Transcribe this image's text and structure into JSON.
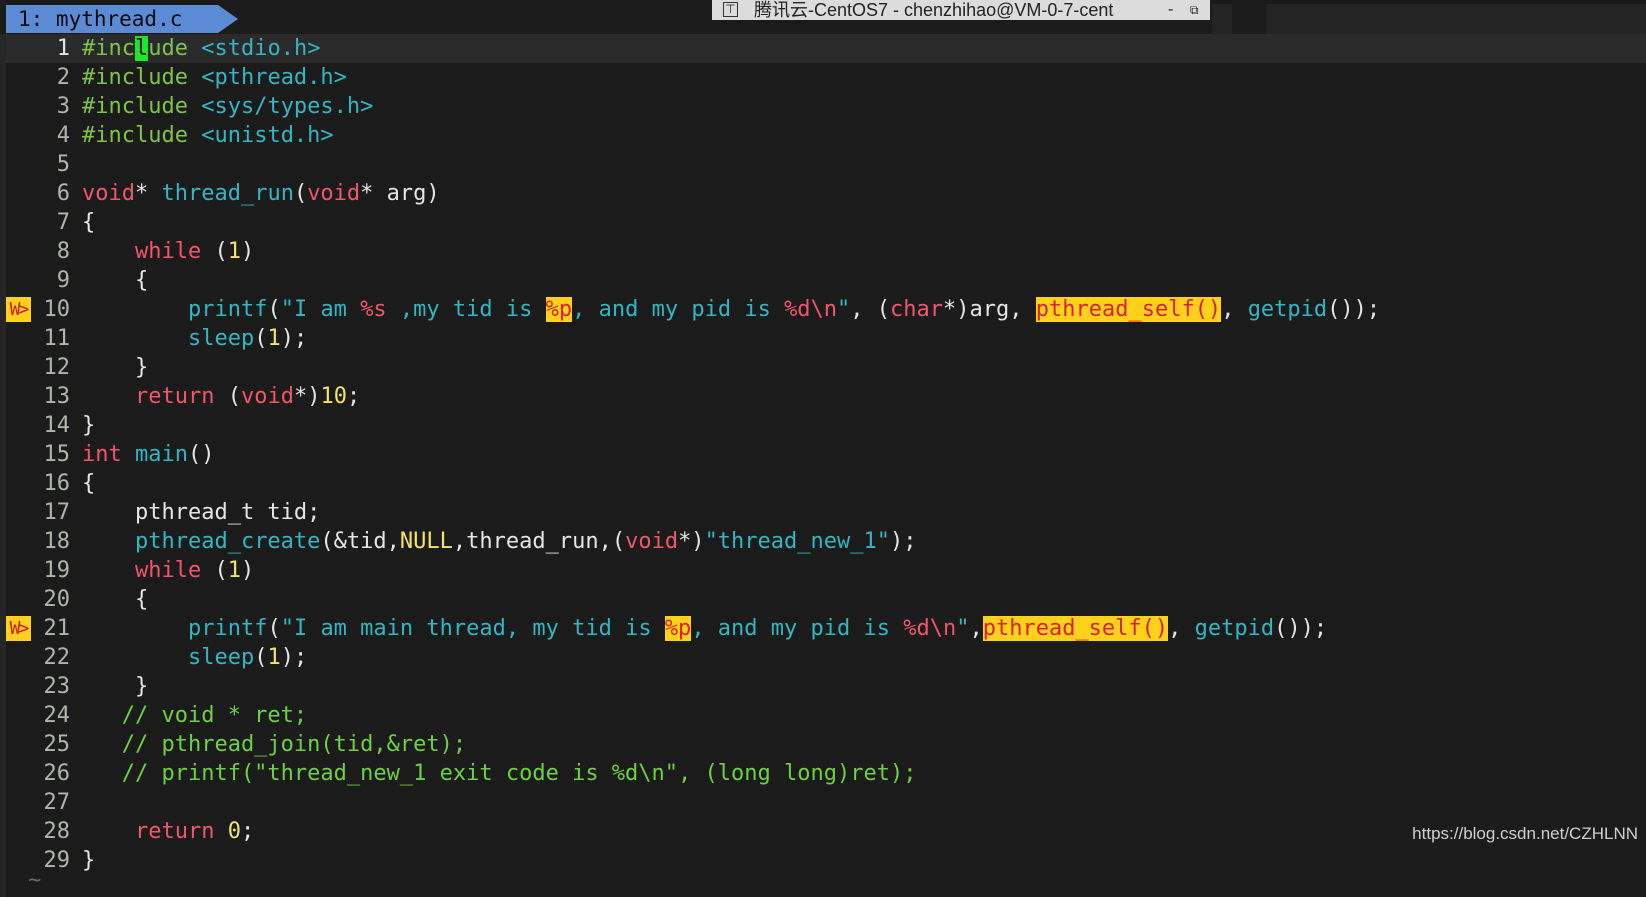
{
  "tab": {
    "label": "1: mythread.c"
  },
  "window_title": {
    "text": "腾讯云-CentOS7 - chenzhihao@VM-0-7-cent",
    "minimize": "-",
    "restore": "⧉"
  },
  "editor": {
    "current_line": 1,
    "cursor_col": 6,
    "sign_text": "W>",
    "lines": [
      {
        "n": "1",
        "sign": false,
        "tokens": [
          {
            "t": "#inc",
            "c": "pre"
          },
          {
            "t": "l",
            "c": "cursor"
          },
          {
            "t": "ude",
            "c": "pre"
          },
          {
            "t": " ",
            "c": ""
          },
          {
            "t": "<stdio.h>",
            "c": "inc"
          }
        ]
      },
      {
        "n": "2",
        "sign": false,
        "tokens": [
          {
            "t": "#include",
            "c": "pre"
          },
          {
            "t": " ",
            "c": ""
          },
          {
            "t": "<pthread.h>",
            "c": "inc"
          }
        ]
      },
      {
        "n": "3",
        "sign": false,
        "tokens": [
          {
            "t": "#include",
            "c": "pre"
          },
          {
            "t": " ",
            "c": ""
          },
          {
            "t": "<sys/types.h>",
            "c": "inc"
          }
        ]
      },
      {
        "n": "4",
        "sign": false,
        "tokens": [
          {
            "t": "#include",
            "c": "pre"
          },
          {
            "t": " ",
            "c": ""
          },
          {
            "t": "<unistd.h>",
            "c": "inc"
          }
        ]
      },
      {
        "n": "5",
        "sign": false,
        "tokens": []
      },
      {
        "n": "6",
        "sign": false,
        "tokens": [
          {
            "t": "void",
            "c": "kw"
          },
          {
            "t": "* ",
            "c": ""
          },
          {
            "t": "thread_run",
            "c": "fn"
          },
          {
            "t": "(",
            "c": ""
          },
          {
            "t": "void",
            "c": "kw"
          },
          {
            "t": "* arg)",
            "c": ""
          }
        ]
      },
      {
        "n": "7",
        "sign": false,
        "tokens": [
          {
            "t": "{",
            "c": ""
          }
        ]
      },
      {
        "n": "8",
        "sign": false,
        "tokens": [
          {
            "t": "    ",
            "c": ""
          },
          {
            "t": "while",
            "c": "kw"
          },
          {
            "t": " (",
            "c": ""
          },
          {
            "t": "1",
            "c": "num"
          },
          {
            "t": ")",
            "c": ""
          }
        ]
      },
      {
        "n": "9",
        "sign": false,
        "tokens": [
          {
            "t": "    {",
            "c": ""
          }
        ]
      },
      {
        "n": "10",
        "sign": true,
        "tokens": [
          {
            "t": "        ",
            "c": ""
          },
          {
            "t": "printf",
            "c": "fn"
          },
          {
            "t": "(",
            "c": ""
          },
          {
            "t": "\"I am ",
            "c": "str"
          },
          {
            "t": "%s",
            "c": "fmt"
          },
          {
            "t": " ,my tid is ",
            "c": "str"
          },
          {
            "t": "%p",
            "c": "hl"
          },
          {
            "t": ", and my pid is ",
            "c": "str"
          },
          {
            "t": "%d\\n",
            "c": "fmt"
          },
          {
            "t": "\"",
            "c": "str"
          },
          {
            "t": ", (",
            "c": ""
          },
          {
            "t": "char",
            "c": "kw"
          },
          {
            "t": "*)arg, ",
            "c": ""
          },
          {
            "t": "pthread_self()",
            "c": "hl"
          },
          {
            "t": ", ",
            "c": ""
          },
          {
            "t": "getpid",
            "c": "fn"
          },
          {
            "t": "());",
            "c": ""
          }
        ]
      },
      {
        "n": "11",
        "sign": false,
        "tokens": [
          {
            "t": "        ",
            "c": ""
          },
          {
            "t": "sleep",
            "c": "fn"
          },
          {
            "t": "(",
            "c": ""
          },
          {
            "t": "1",
            "c": "num"
          },
          {
            "t": ");",
            "c": ""
          }
        ]
      },
      {
        "n": "12",
        "sign": false,
        "tokens": [
          {
            "t": "    }",
            "c": ""
          }
        ]
      },
      {
        "n": "13",
        "sign": false,
        "tokens": [
          {
            "t": "    ",
            "c": ""
          },
          {
            "t": "return",
            "c": "kw"
          },
          {
            "t": " (",
            "c": ""
          },
          {
            "t": "void",
            "c": "kw"
          },
          {
            "t": "*)",
            "c": ""
          },
          {
            "t": "10",
            "c": "num"
          },
          {
            "t": ";",
            "c": ""
          }
        ]
      },
      {
        "n": "14",
        "sign": false,
        "tokens": [
          {
            "t": "}",
            "c": ""
          }
        ]
      },
      {
        "n": "15",
        "sign": false,
        "tokens": [
          {
            "t": "int",
            "c": "kw"
          },
          {
            "t": " ",
            "c": ""
          },
          {
            "t": "main",
            "c": "fn"
          },
          {
            "t": "()",
            "c": ""
          }
        ]
      },
      {
        "n": "16",
        "sign": false,
        "tokens": [
          {
            "t": "{",
            "c": ""
          }
        ]
      },
      {
        "n": "17",
        "sign": false,
        "tokens": [
          {
            "t": "    pthread_t tid;",
            "c": ""
          }
        ]
      },
      {
        "n": "18",
        "sign": false,
        "tokens": [
          {
            "t": "    ",
            "c": ""
          },
          {
            "t": "pthread_create",
            "c": "fn"
          },
          {
            "t": "(&tid,",
            "c": ""
          },
          {
            "t": "NULL",
            "c": "num"
          },
          {
            "t": ",thread_run,(",
            "c": ""
          },
          {
            "t": "void",
            "c": "kw"
          },
          {
            "t": "*)",
            "c": ""
          },
          {
            "t": "\"thread_new_1\"",
            "c": "str"
          },
          {
            "t": ");",
            "c": ""
          }
        ]
      },
      {
        "n": "19",
        "sign": false,
        "tokens": [
          {
            "t": "    ",
            "c": ""
          },
          {
            "t": "while",
            "c": "kw"
          },
          {
            "t": " (",
            "c": ""
          },
          {
            "t": "1",
            "c": "num"
          },
          {
            "t": ")",
            "c": ""
          }
        ]
      },
      {
        "n": "20",
        "sign": false,
        "tokens": [
          {
            "t": "    {",
            "c": ""
          }
        ]
      },
      {
        "n": "21",
        "sign": true,
        "tokens": [
          {
            "t": "        ",
            "c": ""
          },
          {
            "t": "printf",
            "c": "fn"
          },
          {
            "t": "(",
            "c": ""
          },
          {
            "t": "\"I am main thread, my tid is ",
            "c": "str"
          },
          {
            "t": "%p",
            "c": "hl"
          },
          {
            "t": ", and my pid is ",
            "c": "str"
          },
          {
            "t": "%d\\n",
            "c": "fmt"
          },
          {
            "t": "\"",
            "c": "str"
          },
          {
            "t": ",",
            "c": ""
          },
          {
            "t": "pthread_self()",
            "c": "hl"
          },
          {
            "t": ", ",
            "c": ""
          },
          {
            "t": "getpid",
            "c": "fn"
          },
          {
            "t": "());",
            "c": ""
          }
        ]
      },
      {
        "n": "22",
        "sign": false,
        "tokens": [
          {
            "t": "        ",
            "c": ""
          },
          {
            "t": "sleep",
            "c": "fn"
          },
          {
            "t": "(",
            "c": ""
          },
          {
            "t": "1",
            "c": "num"
          },
          {
            "t": ");",
            "c": ""
          }
        ]
      },
      {
        "n": "23",
        "sign": false,
        "tokens": [
          {
            "t": "    }",
            "c": ""
          }
        ]
      },
      {
        "n": "24",
        "sign": false,
        "tokens": [
          {
            "t": "   // void * ret;",
            "c": "cmt"
          }
        ]
      },
      {
        "n": "25",
        "sign": false,
        "tokens": [
          {
            "t": "   // pthread_join(tid,&ret);",
            "c": "cmt"
          }
        ]
      },
      {
        "n": "26",
        "sign": false,
        "tokens": [
          {
            "t": "   // printf(\"thread_new_1 exit code is %d\\n\", (long long)ret);",
            "c": "cmt"
          }
        ]
      },
      {
        "n": "27",
        "sign": false,
        "tokens": []
      },
      {
        "n": "28",
        "sign": false,
        "tokens": [
          {
            "t": "    ",
            "c": ""
          },
          {
            "t": "return",
            "c": "kw"
          },
          {
            "t": " ",
            "c": ""
          },
          {
            "t": "0",
            "c": "num"
          },
          {
            "t": ";",
            "c": ""
          }
        ]
      },
      {
        "n": "29",
        "sign": false,
        "tokens": [
          {
            "t": "}",
            "c": ""
          }
        ]
      }
    ],
    "end_of_buffer": "~"
  },
  "watermark": "https://blog.csdn.net/CZHLNN",
  "colors": {
    "background": "#1b1b1b",
    "tab_active": "#5c8bd6",
    "keyword": "#f0566a",
    "function": "#34b5c4",
    "preproc": "#7ec34a",
    "number": "#f2e36b",
    "comment": "#6cd143",
    "warning_highlight": "#ffd11a",
    "cursor": "#1fe62d"
  }
}
